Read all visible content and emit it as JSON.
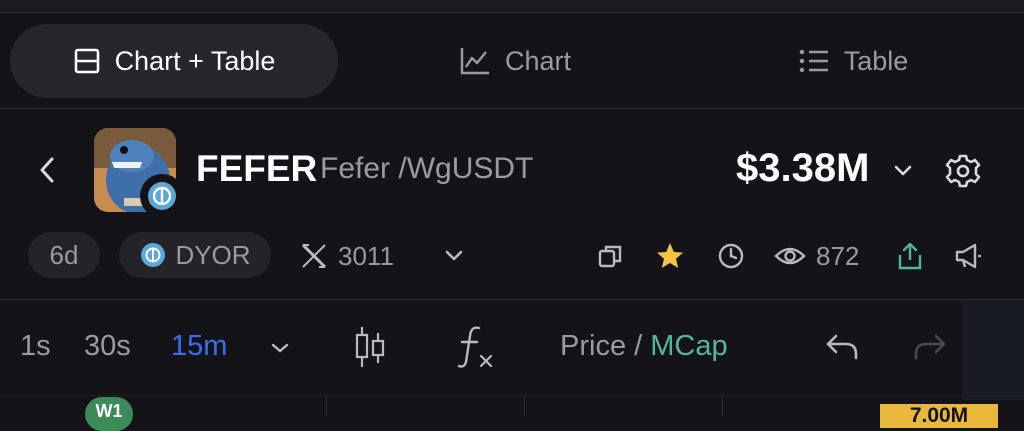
{
  "view_tabs": [
    {
      "label": "Chart + Table",
      "icon": "split-layout-icon",
      "active": true
    },
    {
      "label": "Chart",
      "icon": "line-chart-icon",
      "active": false
    },
    {
      "label": "Table",
      "icon": "list-icon",
      "active": false
    }
  ],
  "token": {
    "symbol": "FEFER",
    "pair": "Fefer /WgUSDT",
    "market_cap": "$3.38M"
  },
  "meta": {
    "age": "6d",
    "dyor_label": "DYOR",
    "x_count": "3011",
    "views": "872"
  },
  "toolbar": {
    "timeframes": [
      "1s",
      "30s",
      "15m"
    ],
    "active_timeframe": "15m",
    "price_label": "Price",
    "divider": "/",
    "mcap_label": "MCap"
  },
  "chart": {
    "marker_label": "W1",
    "price_tag": "7.00M"
  },
  "colors": {
    "background": "#141418",
    "accent_blue": "#3d6cf2",
    "accent_green": "#4fb79a",
    "star": "#f5c341",
    "price_tag": "#e9b73a"
  }
}
